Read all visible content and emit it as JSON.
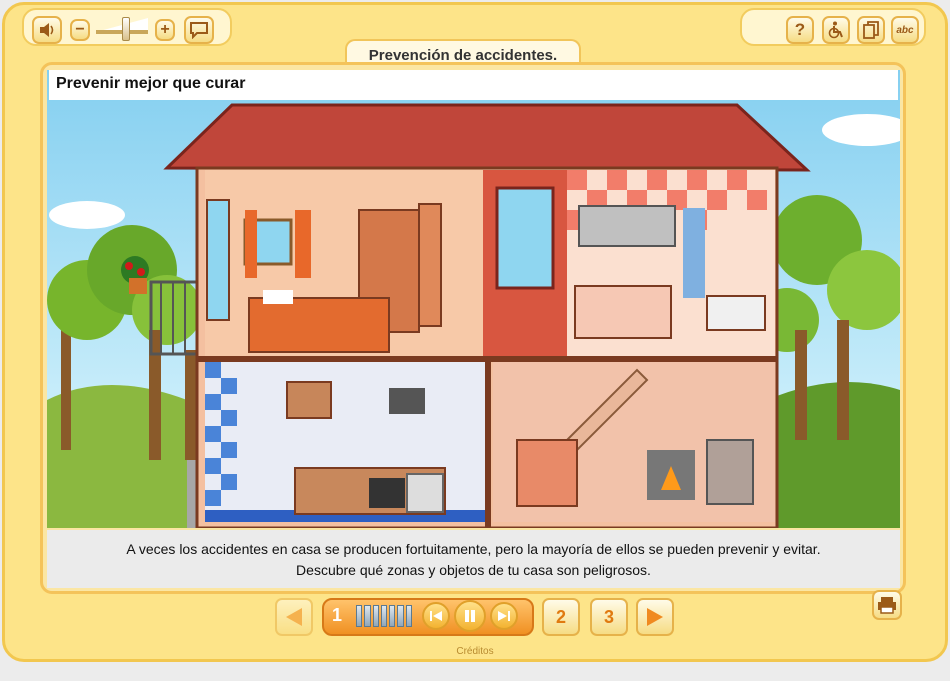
{
  "header": {
    "tab_title": "Prevención de accidentes."
  },
  "toolbar_left": {
    "sound_icon": "speaker-icon",
    "volume_down": "−",
    "volume_up": "+",
    "volume_level": 0.55,
    "speech_icon": "speech-bubble-icon"
  },
  "toolbar_right": {
    "help": "?",
    "accessibility_icon": "wheelchair-icon",
    "copy_icon": "copy-icon",
    "text": "abc"
  },
  "scene": {
    "title": "Prevenir mejor que curar"
  },
  "caption": {
    "line1": "A veces los accidentes en casa se producen fortuitamente, pero la mayoría de ellos se pueden prevenir y evitar.",
    "line2": "Descubre qué zonas y objetos de tu casa son peligrosos."
  },
  "navigation": {
    "current_page": "1",
    "progress_segments": 7,
    "page2": "2",
    "page3": "3"
  },
  "footer": {
    "credits": "Créditos"
  },
  "colors": {
    "frame": "#fde489",
    "accent": "#f09022",
    "roof": "#c0463a",
    "wall": "#f4c0a0"
  }
}
